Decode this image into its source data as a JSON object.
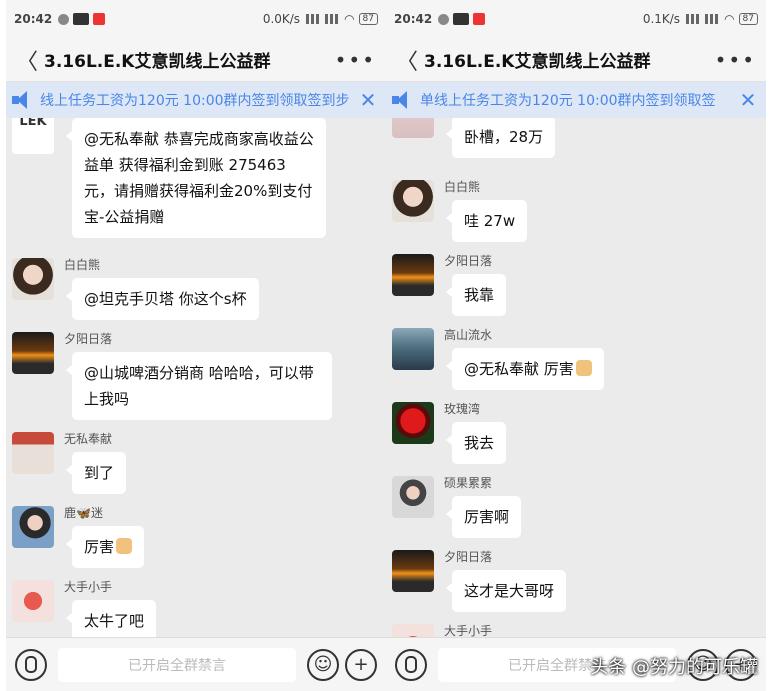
{
  "left": {
    "status": {
      "time": "20:42",
      "net": "0.0K/s",
      "battery": "87"
    },
    "title": "3.16L.E.K艾意凯线上公益群",
    "notice": "线上任务工资为120元  10:00群内签到领取签到步",
    "input_placeholder": "已开启全群禁言",
    "messages": [
      {
        "sender": "",
        "avatar": "LEK",
        "text": "@无私奉献 恭喜完成商家高收益公益单 获得福利金到账 275463元，请捐赠获得福利金20%到支付宝-公益捐赠"
      },
      {
        "sender": "白白熊",
        "text": "@坦克手贝塔 你这个s杯"
      },
      {
        "sender": "夕阳日落",
        "text": "@山城啤酒分销商 哈哈哈，可以带上我吗"
      },
      {
        "sender": "无私奉献",
        "text": "到了"
      },
      {
        "sender": "鹿🦋迷",
        "text": "厉害"
      },
      {
        "sender": "大手小手",
        "text": "太牛了吧"
      }
    ]
  },
  "right": {
    "status": {
      "time": "20:42",
      "net": "0.1K/s",
      "battery": "87"
    },
    "title": "3.16L.E.K艾意凯线上公益群",
    "notice": "单线上任务工资为120元  10:00群内签到领取签",
    "input_placeholder": "已开启全群禁言",
    "messages": [
      {
        "sender": "",
        "text": "卧槽，28万"
      },
      {
        "sender": "白白熊",
        "text": "哇 27w"
      },
      {
        "sender": "夕阳日落",
        "text": "我靠"
      },
      {
        "sender": "高山流水",
        "text": "@无私奉献 厉害"
      },
      {
        "sender": "玫瑰湾",
        "text": "我去"
      },
      {
        "sender": "硕果累累",
        "text": "厉害啊"
      },
      {
        "sender": "夕阳日落",
        "text": "这才是大哥呀"
      },
      {
        "sender": "大手小手",
        "text": ""
      }
    ]
  },
  "watermark": "头条 @努力的可乐罐"
}
